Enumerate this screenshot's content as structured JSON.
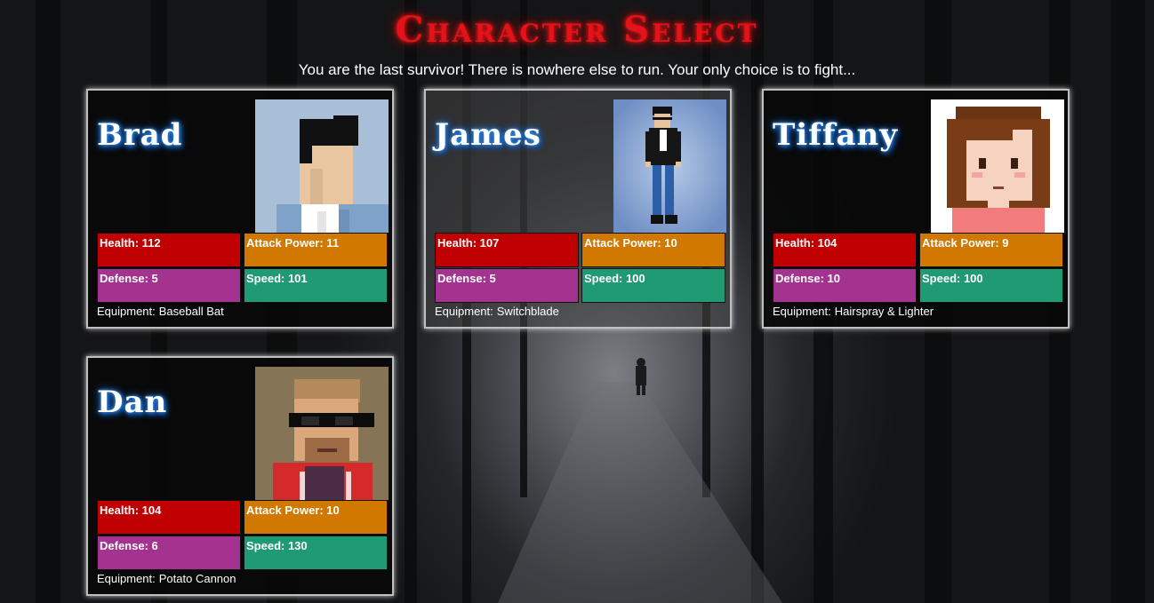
{
  "title": "Character Select",
  "subtitle": "You are the last survivor! There is nowhere else to run. Your only choice is to fight...",
  "characters": [
    {
      "name": "Brad",
      "health": "Health: 112",
      "attack": "Attack Power: 11",
      "defense": "Defense: 5",
      "speed": "Speed: 101",
      "equipment_label": "Equipment:",
      "equipment": "Baseball Bat",
      "portrait": "brad-portrait"
    },
    {
      "name": "James",
      "health": "Health: 107",
      "attack": "Attack Power: 10",
      "defense": "Defense: 5",
      "speed": "Speed: 100",
      "equipment_label": "Equipment:",
      "equipment": "Switchblade",
      "portrait": "james-portrait"
    },
    {
      "name": "Tiffany",
      "health": "Health: 104",
      "attack": "Attack Power: 9",
      "defense": "Defense: 10",
      "speed": "Speed: 100",
      "equipment_label": "Equipment:",
      "equipment": "Hairspray & Lighter",
      "portrait": "tiffany-portrait"
    },
    {
      "name": "Dan",
      "health": "Health: 104",
      "attack": "Attack Power: 10",
      "defense": "Defense: 6",
      "speed": "Speed: 130",
      "equipment_label": "Equipment:",
      "equipment": "Potato Cannon",
      "portrait": "dan-portrait"
    }
  ],
  "colors": {
    "title": "#e5121a",
    "health": "#c00000",
    "attack": "#d07800",
    "defense": "#a3338f",
    "speed": "#1f9a73"
  }
}
